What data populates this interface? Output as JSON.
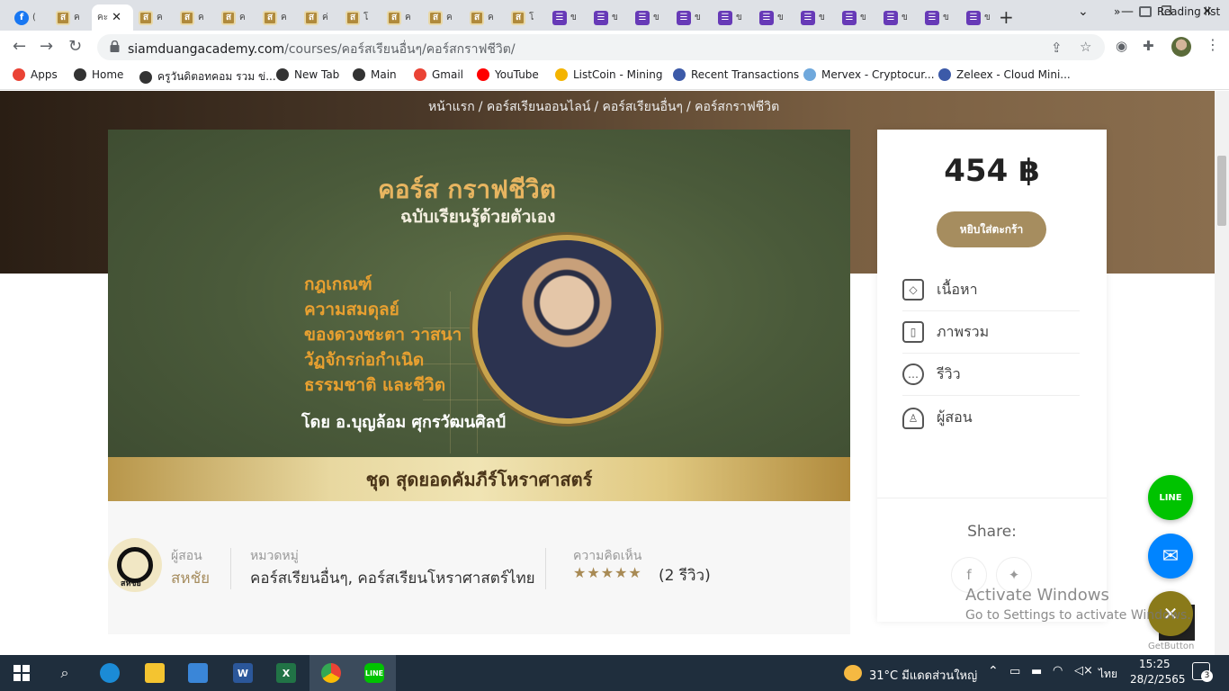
{
  "browser": {
    "tabs": [
      {
        "label": "(",
        "icon": "facebook-icon"
      },
      {
        "label": "ค",
        "icon": "site-icon"
      },
      {
        "label": "คะ",
        "icon": "site-icon",
        "active": true
      },
      {
        "label": "ค",
        "icon": "site-icon"
      },
      {
        "label": "ค",
        "icon": "site-icon"
      },
      {
        "label": "ค",
        "icon": "site-icon"
      },
      {
        "label": "ค",
        "icon": "site-icon"
      },
      {
        "label": "ค่",
        "icon": "site-icon"
      },
      {
        "label": "โ",
        "icon": "site-icon"
      },
      {
        "label": "ค",
        "icon": "site-icon"
      },
      {
        "label": "ค",
        "icon": "site-icon"
      },
      {
        "label": "ค",
        "icon": "site-icon"
      },
      {
        "label": "โ",
        "icon": "site-icon"
      },
      {
        "label": "ข",
        "icon": "form-icon"
      },
      {
        "label": "ข",
        "icon": "form-icon"
      },
      {
        "label": "ข",
        "icon": "form-icon"
      },
      {
        "label": "ข",
        "icon": "form-icon"
      },
      {
        "label": "ข",
        "icon": "form-icon"
      },
      {
        "label": "ข",
        "icon": "form-icon"
      },
      {
        "label": "ข",
        "icon": "form-icon"
      },
      {
        "label": "ข",
        "icon": "form-icon"
      },
      {
        "label": "ข",
        "icon": "form-icon"
      },
      {
        "label": "ข",
        "icon": "form-icon"
      },
      {
        "label": "ข",
        "icon": "form-icon"
      }
    ],
    "url_domain": "siamduangacademy.com",
    "url_path": "/courses/คอร์สเรียนอื่นๆ/คอร์สกราฟชีวิต/",
    "bookmarks": [
      {
        "label": "Apps",
        "color": "#ea4335"
      },
      {
        "label": "Home",
        "color": "#333333"
      },
      {
        "label": "ครูวันดิตอทคอม รวม ข่...",
        "color": "#333333"
      },
      {
        "label": "New Tab",
        "color": "#333333"
      },
      {
        "label": "Main",
        "color": "#333333"
      },
      {
        "label": "Gmail",
        "color": "#ea4335"
      },
      {
        "label": "YouTube",
        "color": "#ff0000"
      },
      {
        "label": "ListCoin - Mining",
        "color": "#f4b400"
      },
      {
        "label": "Recent Transactions",
        "color": "#3c5aa8"
      },
      {
        "label": "Mervex - Cryptocur...",
        "color": "#6fa8dc"
      },
      {
        "label": "Zeleex - Cloud Mini...",
        "color": "#3c5aa8"
      }
    ],
    "bookmarks_overflow": "»",
    "reading_list": "Reading list"
  },
  "page": {
    "breadcrumb": [
      "หน้าแรก",
      "/ คอร์สเรียนออนไลน์",
      "/ คอร์สเรียนอื่นๆ",
      "/ คอร์สกราฟชีวิต"
    ],
    "banner": {
      "title": "คอร์ส กราฟชีวิต",
      "subtitle": "ฉบับเรียนรู้ด้วยตัวเอง",
      "lines": [
        "กฎเกณฑ์",
        "ความสมดุลย์",
        "ของดวงชะตา วาสนา",
        "วัฏจักรก่อกำเนิด",
        "ธรรมชาติ และชีวิต"
      ],
      "author": "โดย อ.บุญล้อม ศุกรวัฒนศิลป์",
      "series": "ชุด สุดยอดคัมภีร์โหราศาสตร์"
    },
    "meta": {
      "instructor_label": "ผู้สอน",
      "instructor_name": "สหชัย",
      "logo_text": "สหชัย",
      "category_label": "หมวดหมู่",
      "category_value": "คอร์สเรียนอื่นๆ, คอร์สเรียนโหราศาสตร์ไทย",
      "review_label": "ความคิดเห็น",
      "rating": 5,
      "stars": "★★★★★",
      "review_count": "(2 รีวิว)"
    },
    "sidebar": {
      "price": "454 ฿",
      "add_to_cart": "หยิบใส่ตะกร้า",
      "items": [
        {
          "label": "เนื้อหา",
          "icon": "tag-icon"
        },
        {
          "label": "ภาพรวม",
          "icon": "document-icon"
        },
        {
          "label": "รีวิว",
          "icon": "chat-icon"
        },
        {
          "label": "ผู้สอน",
          "icon": "user-icon"
        }
      ],
      "share_label": "Share:"
    },
    "floating": {
      "line_label": "LINE",
      "getbutton": "GetButton"
    },
    "watermark": {
      "line1": "Activate Windows",
      "line2": "Go to Settings to activate Windows."
    }
  },
  "taskbar": {
    "weather": "31°C มีแดดส่วนใหญ่",
    "language": "ไทย",
    "time": "15:25",
    "date": "28/2/2565",
    "notifications": "3"
  }
}
